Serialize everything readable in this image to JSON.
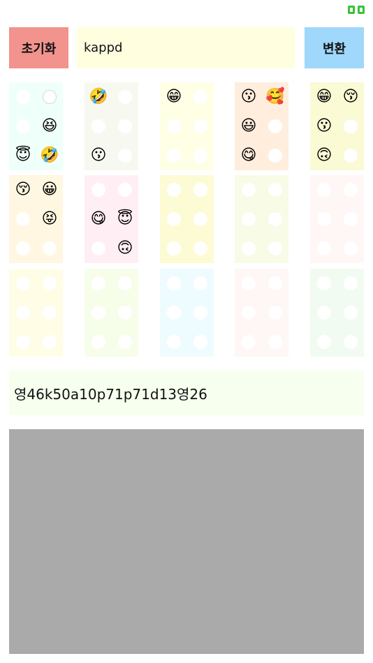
{
  "toolbar": {
    "reset_label": "초기화",
    "convert_label": "변환",
    "input_value": "kappd"
  },
  "status": {
    "icon": "battery-icon",
    "color": "#3ac23a"
  },
  "braille_grid": [
    {
      "color": "#effff9",
      "dots": [
        "",
        "outlined",
        "",
        "😆",
        "😇",
        "🤣"
      ]
    },
    {
      "color": "#f7f9f1",
      "dots": [
        "🤣",
        "",
        "",
        "",
        "😗",
        ""
      ]
    },
    {
      "color": "#ffffe6",
      "dots": [
        "😁",
        "",
        "",
        "",
        "",
        ""
      ]
    },
    {
      "color": "#ffeedd",
      "dots": [
        "😗",
        "🥰",
        "😃",
        "",
        "😋",
        ""
      ]
    },
    {
      "color": "#fafad4",
      "dots": [
        "😁",
        "😚",
        "😗",
        "",
        "🙃",
        ""
      ]
    },
    {
      "color": "#fff7e1",
      "dots": [
        "😚",
        "😀",
        "",
        "😝",
        "",
        ""
      ]
    },
    {
      "color": "#ffeef3",
      "dots": [
        "",
        "",
        "😋",
        "😇",
        "",
        "🙃"
      ]
    },
    {
      "color": "#fdfbd4",
      "dots": [
        "",
        "",
        "",
        "",
        "",
        ""
      ]
    },
    {
      "color": "#f8fbe5",
      "dots": [
        "",
        "",
        "",
        "",
        "",
        ""
      ]
    },
    {
      "color": "#fff7f5",
      "dots": [
        "",
        "",
        "",
        "",
        "",
        ""
      ]
    },
    {
      "color": "#fffde6",
      "dots": [
        "",
        "",
        "",
        "",
        "",
        ""
      ]
    },
    {
      "color": "#f6feea",
      "dots": [
        "",
        "",
        "",
        "",
        "",
        ""
      ]
    },
    {
      "color": "#effcff",
      "dots": [
        "",
        "",
        "",
        "",
        "",
        ""
      ]
    },
    {
      "color": "#fff7f6",
      "dots": [
        "",
        "",
        "",
        "",
        "",
        ""
      ]
    },
    {
      "color": "#f1fbf1",
      "dots": [
        "",
        "",
        "",
        "",
        "",
        ""
      ]
    }
  ],
  "output_text": "영46k50a10p71p71d13영26"
}
